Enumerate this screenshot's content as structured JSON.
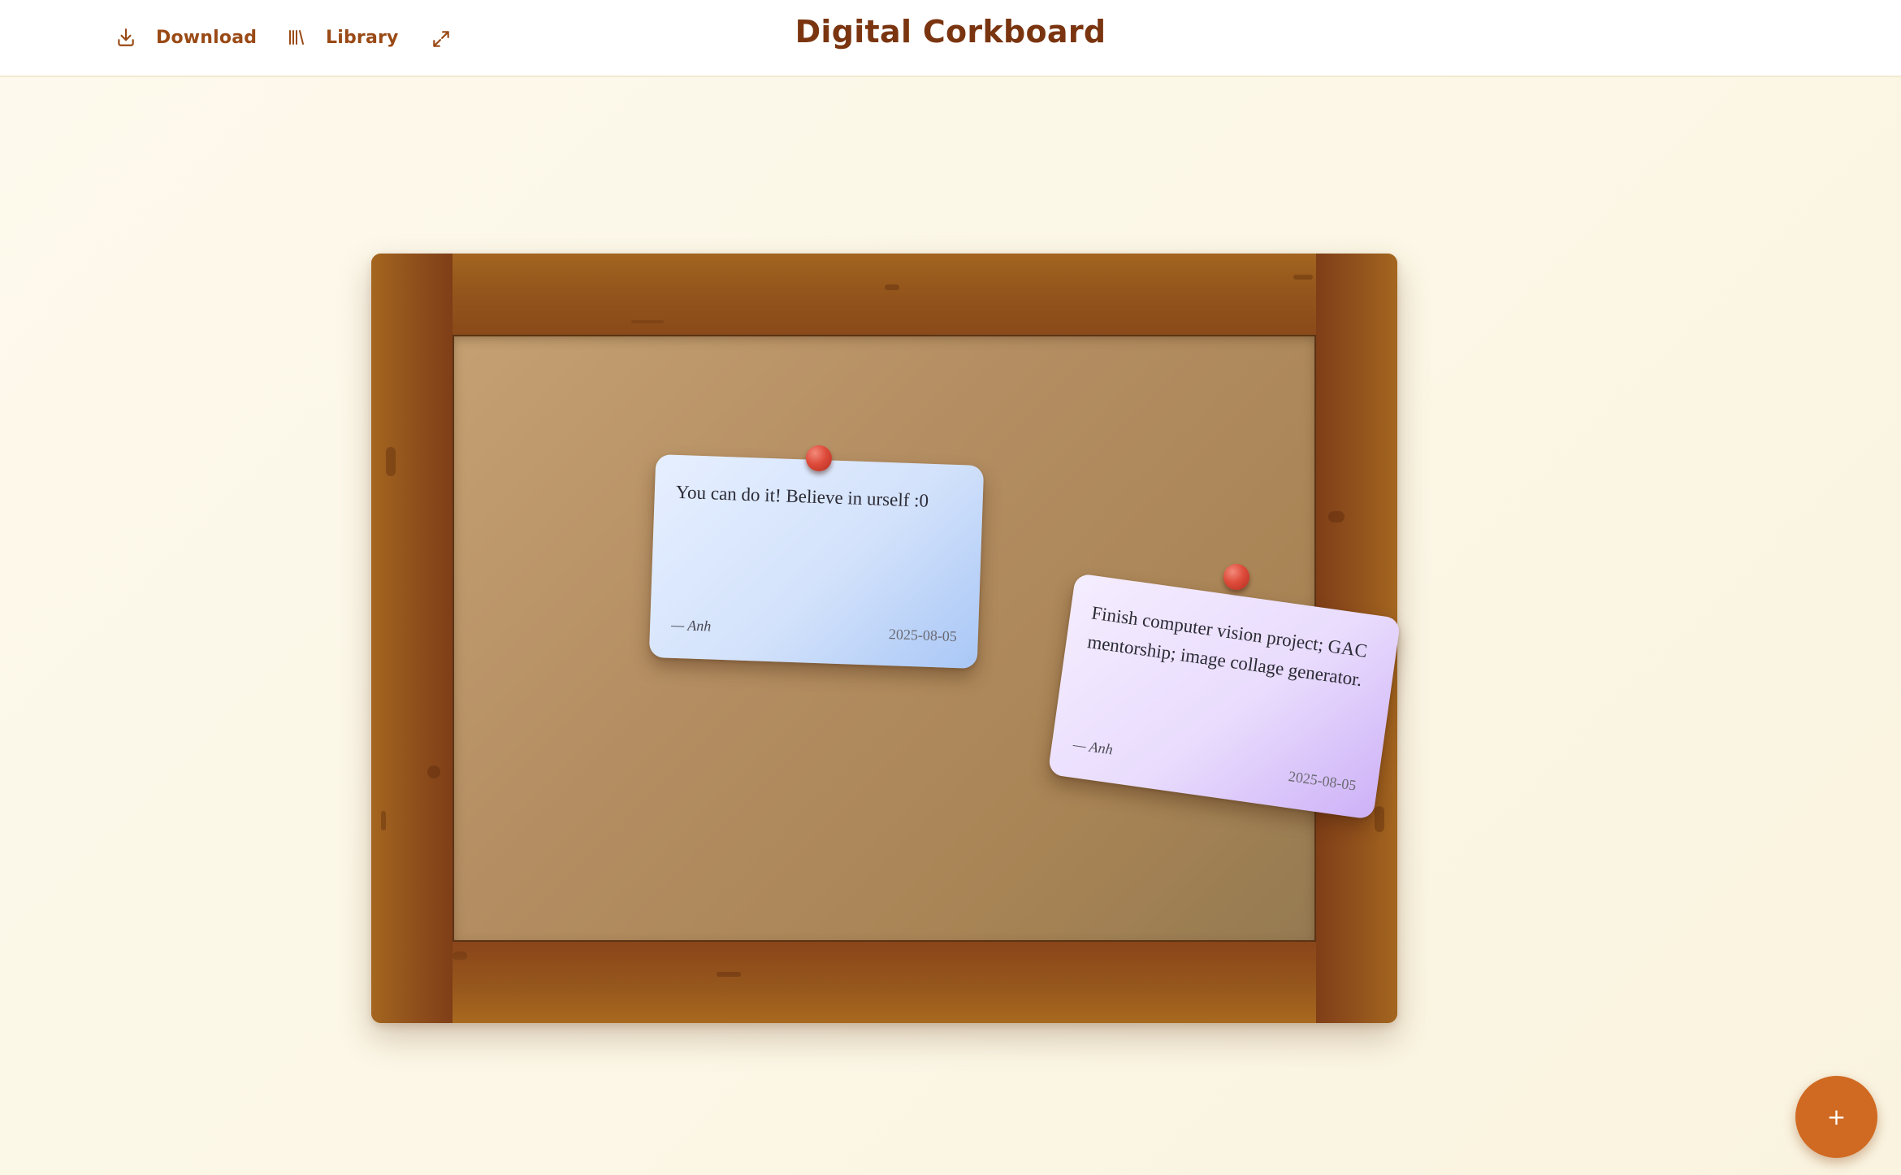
{
  "header": {
    "title": "Digital Corkboard",
    "download_label": "Download",
    "library_label": "Library"
  },
  "icons": {
    "download": "download-icon",
    "library": "library-icon",
    "expand": "expand-icon"
  },
  "notes": [
    {
      "text": "You can do it! Believe in urself :0",
      "author": "— Anh",
      "date": "2025-08-05",
      "color": "#cfe0fb"
    },
    {
      "text": "Finish computer vision project; GAC mentorship; image collage generator.",
      "author": "— Anh",
      "date": "2025-08-05",
      "color": "#e6d8fd"
    }
  ],
  "fab": {
    "label": "+"
  },
  "colors": {
    "accent": "#d06a22",
    "title": "#7a3510",
    "nav": "#9a4a16",
    "pin": "#de4b3a",
    "frame_wood": "#94561c",
    "cork": "#b48e62"
  }
}
